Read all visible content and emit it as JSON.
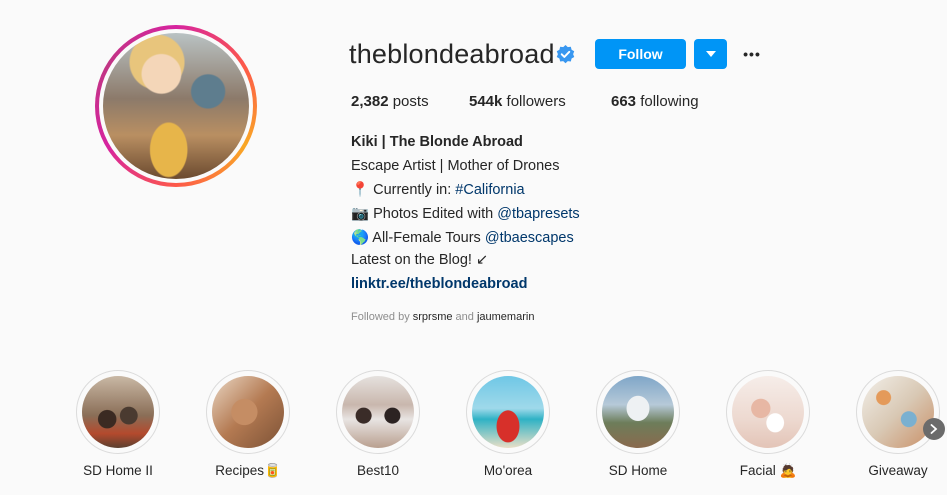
{
  "profile": {
    "username": "theblondeabroad",
    "follow_label": "Follow",
    "more_label": "•••",
    "stats": {
      "posts_value": "2,382",
      "posts_label": " posts",
      "followers_value": "544k",
      "followers_label": " followers",
      "following_value": "663",
      "following_label": " following"
    }
  },
  "bio": {
    "name": "Kiki | The Blonde Abroad",
    "line1": "Escape Artist | Mother of Drones",
    "line2_icon": "📍",
    "line2_text": " Currently in: ",
    "line2_tag": "#California",
    "line3_icon": "📷",
    "line3_text": " Photos Edited with ",
    "line3_tag": "@tbapresets",
    "line4_icon": "🌎",
    "line4_text": " All-Female Tours ",
    "line4_tag": "@tbaescapes",
    "line5": "Latest on the Blog! ↙",
    "link": "linktr.ee/theblondeabroad",
    "followed_prefix": "Followed by ",
    "followed_user1": "srprsme",
    "followed_and": " and ",
    "followed_user2": "jaumemarin"
  },
  "highlights": [
    {
      "label": "SD Home II"
    },
    {
      "label": "Recipes🥫"
    },
    {
      "label": "Best10"
    },
    {
      "label": "Mo'orea"
    },
    {
      "label": "SD Home"
    },
    {
      "label": "Facial 🙇"
    },
    {
      "label": "Giveaway"
    }
  ],
  "colors": {
    "accent": "#0095f6",
    "link": "#00376b",
    "verified": "#3897f0"
  },
  "icons": {
    "verified": "verified-badge-icon",
    "dropdown": "chevron-down-icon",
    "more": "more-options-icon",
    "next": "chevron-right-icon"
  }
}
